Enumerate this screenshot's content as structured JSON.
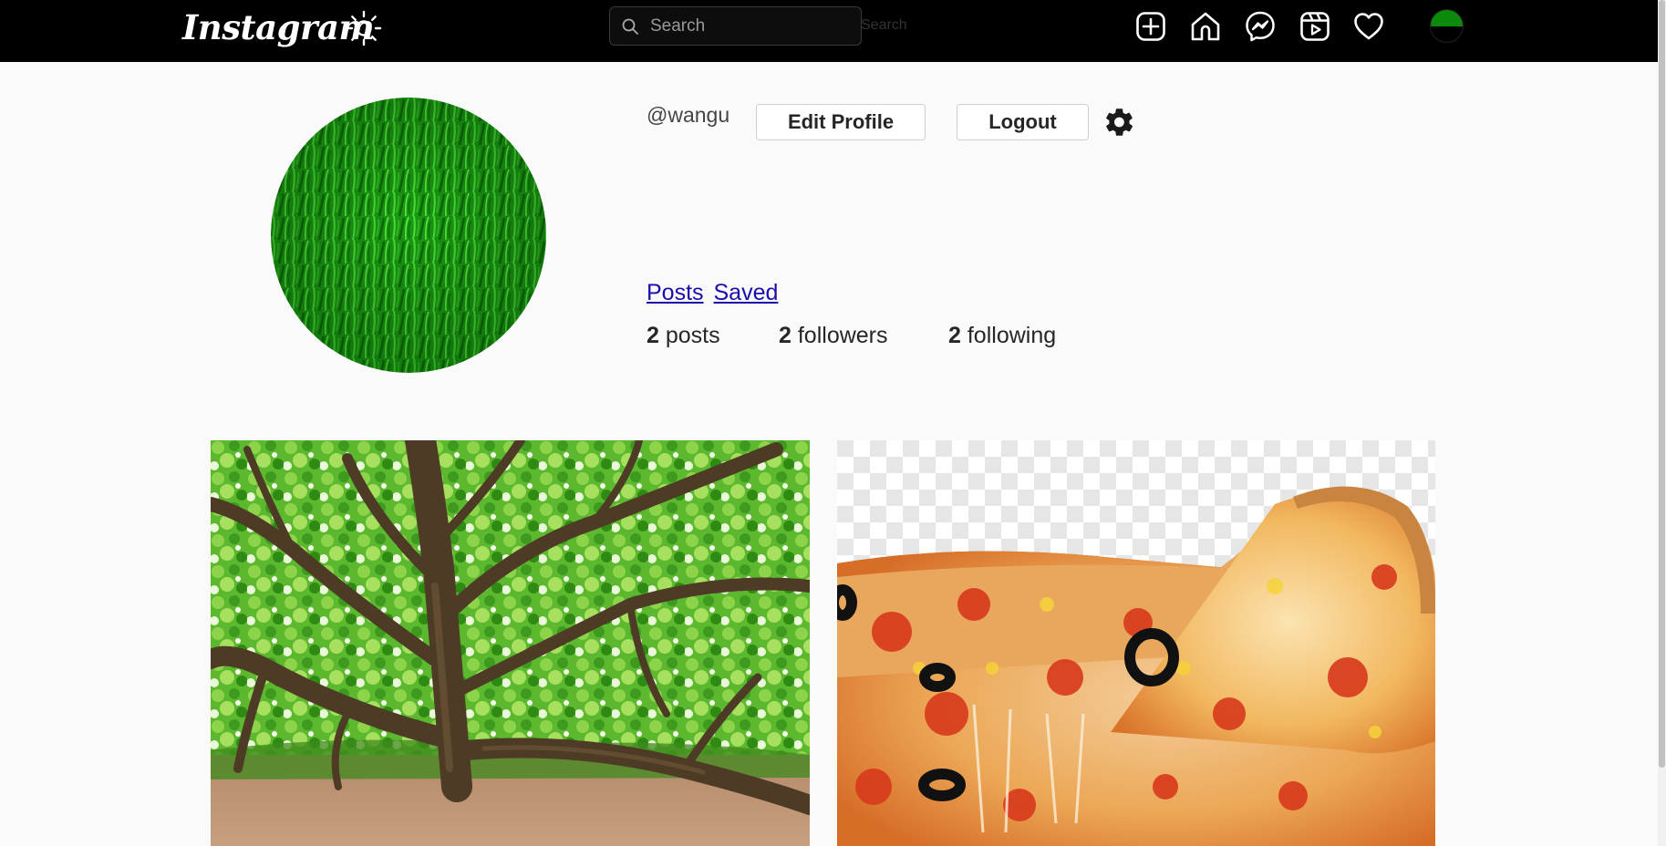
{
  "app": {
    "logo_text": "Instagram"
  },
  "nav": {
    "search_placeholder": "Search",
    "search_ghost_label": "Search",
    "icons": [
      "theme-toggle-icon",
      "create-post-icon",
      "home-icon",
      "messenger-icon",
      "reels-icon",
      "heart-icon",
      "profile-avatar"
    ]
  },
  "profile": {
    "username": "@wangu",
    "edit_profile_label": "Edit Profile",
    "logout_label": "Logout",
    "tabs": {
      "posts": "Posts",
      "saved": "Saved"
    },
    "stats": [
      {
        "count": "2",
        "label": "posts"
      },
      {
        "count": "2",
        "label": "followers"
      },
      {
        "count": "2",
        "label": "following"
      }
    ]
  },
  "posts": [
    {
      "subject": "tree"
    },
    {
      "subject": "pizza"
    }
  ],
  "colors": {
    "topbar": "#000000",
    "page_bg": "#fafafa",
    "link": "#1a0dab",
    "avatar_green": "#0b8a0b"
  }
}
